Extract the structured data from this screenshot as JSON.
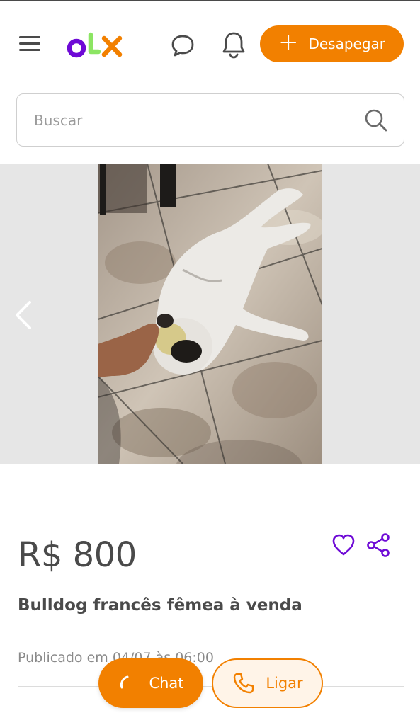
{
  "header": {
    "logo_text": "OLX",
    "sell_button_label": "Desapegar",
    "sell_button_icon": "plus-icon",
    "icons": [
      "menu-icon",
      "chat-bubble-icon",
      "bell-icon"
    ]
  },
  "search": {
    "placeholder": "Buscar",
    "value": "",
    "icon": "search-icon"
  },
  "gallery": {
    "image_subject": "white bulldog lying on a tiled floor",
    "prev_icon": "chevron-left-icon"
  },
  "listing": {
    "price": "R$ 800",
    "title": "Bulldog francês fêmea à venda",
    "published": "Publicado em 04/07 às 06:00",
    "favorite_icon": "heart-icon",
    "share_icon": "share-icon"
  },
  "actions": {
    "chat_label": "Chat",
    "chat_icon": "spinner-icon",
    "call_label": "Ligar",
    "call_icon": "phone-icon"
  },
  "colors": {
    "accent": "#f28000",
    "brand_purple": "#6e0ad6",
    "brand_green": "#8ce563",
    "text": "#4a4a4a"
  }
}
